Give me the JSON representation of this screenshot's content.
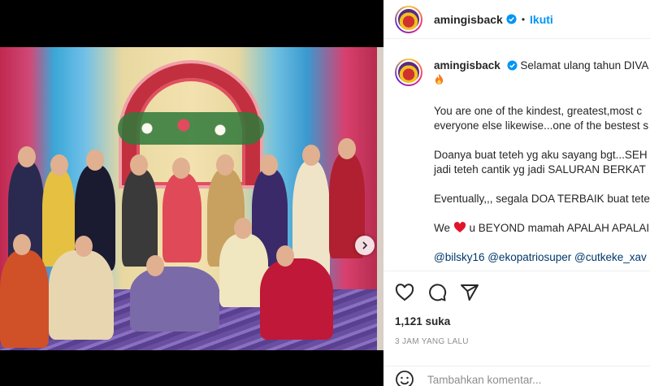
{
  "post": {
    "username": "amingisback",
    "separator": "•",
    "follow_label": "Ikuti",
    "caption": {
      "line1": "Selamat ulang tahun DIVA",
      "para1_line1": "You are one of the kindest, greatest,most c",
      "para1_line2": "everyone else likewise...one of the bestest s",
      "para2_line1": "Doanya buat teteh yg aku sayang bgt...SEH",
      "para2_line2": "jadi teteh cantik yg jadi SALURAN BERKAT",
      "para3": "Eventually,,, segala DOA TERBAIK buat tetel",
      "para4_pre": "We",
      "para4_post": "u BEYOND mamah APALAH APALAI",
      "tags": "@bilsky16 @ekopatriosuper @cutkeke_xav"
    },
    "likes": "1,121 suka",
    "time": "3 JAM YANG LALU",
    "comment_placeholder": "Tambahkan komentar..."
  },
  "carousel": {
    "slide_count": 9,
    "active_index": 0
  },
  "colors": {
    "follow": "#0095f6",
    "verified": "#0095f6",
    "heart": "#ed4956"
  },
  "icons": [
    "verified-badge-icon",
    "fire-emoji-icon",
    "red-heart-emoji-icon",
    "heart-icon",
    "comment-icon",
    "share-icon",
    "emoji-icon",
    "chevron-right-icon"
  ]
}
